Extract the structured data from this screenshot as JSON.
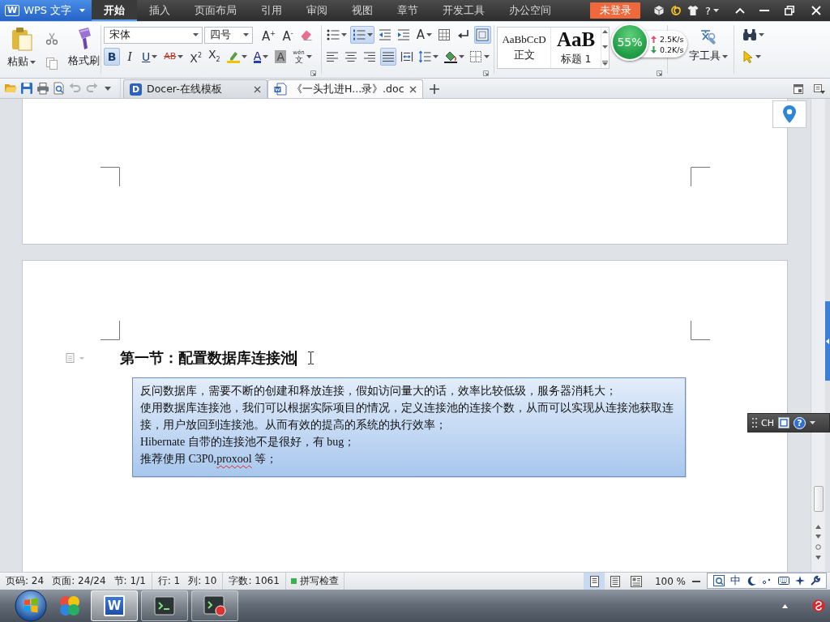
{
  "title_bar": {
    "app_button": {
      "logo": "W",
      "label": "WPS 文字"
    },
    "menu_tabs": [
      {
        "label": "开始",
        "selected": true
      },
      {
        "label": "插入",
        "selected": false
      },
      {
        "label": "页面布局",
        "selected": false
      },
      {
        "label": "引用",
        "selected": false
      },
      {
        "label": "审阅",
        "selected": false
      },
      {
        "label": "视图",
        "selected": false
      },
      {
        "label": "章节",
        "selected": false
      },
      {
        "label": "开发工具",
        "selected": false
      },
      {
        "label": "办公空间",
        "selected": false
      }
    ],
    "login_button": "未登录",
    "help_button": "?"
  },
  "ribbon": {
    "clipboard": {
      "paste": "粘贴",
      "format_painter": "格式刷"
    },
    "font": {
      "font_name": "宋体",
      "font_size": "四号",
      "row1": [
        {
          "kind": "grow-font",
          "label": "A$^{+}$",
          "on": false,
          "dropdown": false
        },
        {
          "kind": "shrink-font",
          "label": "A$^{-}$",
          "on": false,
          "dropdown": false
        },
        {
          "kind": "clear-format",
          "on": false,
          "dropdown": false
        }
      ],
      "row2": [
        {
          "kind": "bold",
          "label": "B",
          "on": true,
          "dropdown": false
        },
        {
          "kind": "italic",
          "label": "I",
          "on": false,
          "dropdown": false
        },
        {
          "kind": "underline",
          "label": "U",
          "on": false,
          "dropdown": true
        },
        {
          "kind": "strikethrough",
          "label": "AB",
          "on": false,
          "dropdown": true
        },
        {
          "kind": "superscript",
          "label": "X$^{2}$",
          "on": false,
          "dropdown": false
        },
        {
          "kind": "subscript",
          "label": "X$_{2}$",
          "on": false,
          "dropdown": false
        },
        {
          "kind": "highlight",
          "on": false,
          "dropdown": true
        },
        {
          "kind": "font-color",
          "label": "A",
          "on": false,
          "dropdown": true
        },
        {
          "kind": "char-shading",
          "label": "A",
          "on": false,
          "dropdown": false
        },
        {
          "kind": "phonetic-guide",
          "label": "文",
          "ruby": "wén",
          "on": false,
          "dropdown": true
        }
      ]
    },
    "paragraph": {
      "row1": [
        {
          "kind": "bullets",
          "on": false,
          "dropdown": true
        },
        {
          "kind": "numbering",
          "on": true,
          "dropdown": true
        },
        {
          "kind": "outdent",
          "on": false,
          "dropdown": false
        },
        {
          "kind": "indent",
          "on": false,
          "dropdown": false
        },
        {
          "kind": "char-scale",
          "label": "A",
          "on": false,
          "dropdown": true
        },
        {
          "kind": "table",
          "on": false,
          "dropdown": false
        },
        {
          "kind": "line-break",
          "on": false,
          "dropdown": false
        },
        {
          "kind": "show-marks",
          "on": true,
          "dropdown": false
        }
      ],
      "row2": [
        {
          "kind": "align-left",
          "on": false,
          "dropdown": false
        },
        {
          "kind": "align-center",
          "on": false,
          "dropdown": false
        },
        {
          "kind": "align-right",
          "on": false,
          "dropdown": false
        },
        {
          "kind": "justify",
          "on": true,
          "dropdown": false
        },
        {
          "kind": "distribute",
          "on": false,
          "dropdown": false
        },
        {
          "kind": "line-spacing",
          "on": false,
          "dropdown": true
        },
        {
          "kind": "shading",
          "on": false,
          "dropdown": true
        },
        {
          "kind": "borders",
          "on": false,
          "dropdown": true
        }
      ]
    },
    "styles": [
      {
        "kind": "body",
        "preview": "AaBbCcD",
        "name": "正文"
      },
      {
        "kind": "heading",
        "preview": "AaB",
        "name": "标题 1"
      }
    ],
    "text_tools": "字工具"
  },
  "network_monitor": {
    "usage": "55%",
    "upload": "2.5K/s",
    "download": "0.2K/s"
  },
  "quick_access": [
    {
      "kind": "open",
      "disabled": false
    },
    {
      "kind": "save",
      "disabled": false
    },
    {
      "kind": "print",
      "disabled": false
    },
    {
      "kind": "print-preview",
      "disabled": false
    },
    {
      "kind": "undo",
      "disabled": true
    },
    {
      "kind": "redo",
      "disabled": true
    },
    {
      "kind": "customize",
      "disabled": false
    }
  ],
  "document_tabs": [
    {
      "kind": "online-templates",
      "logo": "D",
      "label": "Docer-在线模板",
      "selected": false
    },
    {
      "kind": "document",
      "label": "《一头扎进H...录》.doc",
      "selected": true
    }
  ],
  "document": {
    "heading": "第一节：配置数据库连接池",
    "text_box": [
      {
        "segments": [
          {
            "text": "反问数据库，需要不断的创建和释放连接，假如访问量大的话，效率比较低级，服务器消耗大；",
            "spell_error": false
          }
        ]
      },
      {
        "segments": [
          {
            "text": "使用数据库连接池，我们可以根据实际项目的情况，定义连接池的连接个数，从而可以实现从连接池获取连接，用户放回到连接池。从而有效的提高的系统的执行效率；",
            "spell_error": false
          }
        ]
      },
      {
        "segments": [
          {
            "text": "Hibernate 自带的连接池不是很好，有 bug；",
            "spell_error": false
          }
        ]
      },
      {
        "segments": [
          {
            "text": "推荐使用 C3P0,",
            "spell_error": false
          },
          {
            "text": "proxool",
            "spell_error": true
          },
          {
            "text": " 等；",
            "spell_error": false
          }
        ]
      }
    ]
  },
  "ime_toolbar": {
    "label": "CH",
    "help": "?"
  },
  "status_bar": {
    "field_groups": [
      [
        "页码: 24",
        "页面: 24/24",
        "节: 1/1"
      ],
      [
        "行: 1",
        "列: 10"
      ],
      [
        "字数: 1061"
      ]
    ],
    "spell_check": {
      "label": "拼写检查",
      "on": true
    },
    "views": [
      {
        "kind": "page",
        "selected": true
      },
      {
        "kind": "outline",
        "selected": false
      },
      {
        "kind": "web",
        "selected": false
      }
    ],
    "zoom": "100 %"
  },
  "ime_status": {
    "mode": "中"
  },
  "taskbar": {
    "apps": [
      {
        "kind": "circles",
        "running": false,
        "selected": false
      },
      {
        "kind": "letter-tile",
        "label": "W",
        "running": true,
        "selected": true
      },
      {
        "kind": "terminal",
        "running": true,
        "selected": false
      },
      {
        "kind": "terminal-badge",
        "running": true,
        "selected": false
      }
    ]
  }
}
